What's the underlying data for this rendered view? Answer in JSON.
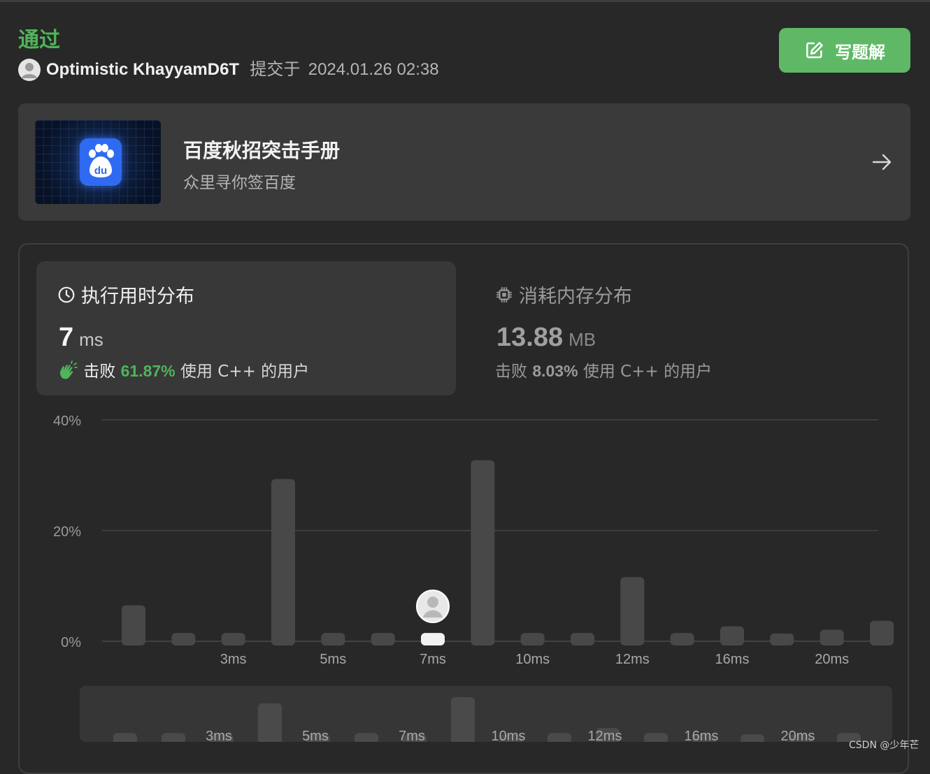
{
  "header": {
    "status": "通过",
    "username": "Optimistic KhayyamD6T",
    "submitted_label": "提交于",
    "submitted_time": "2024.01.26 02:38"
  },
  "write_button": {
    "label": "写题解",
    "icon": "edit-icon"
  },
  "promo": {
    "title": "百度秋招突击手册",
    "subtitle": "众里寻你签百度",
    "image_icon": "baidu-logo",
    "arrow_icon": "arrow-right-icon"
  },
  "runtime": {
    "title": "执行用时分布",
    "icon": "clock-icon",
    "value": "7",
    "unit": "ms",
    "beat_prefix": "击败",
    "beat_percent": "61.87%",
    "beat_suffix": "使用 C++ 的用户",
    "beat_icon": "clap-icon"
  },
  "memory": {
    "title": "消耗内存分布",
    "icon": "chip-icon",
    "value": "13.88",
    "unit": "MB",
    "beat_prefix": "击败",
    "beat_percent": "8.03%",
    "beat_suffix": "使用 C++ 的用户"
  },
  "chart_data": {
    "type": "bar",
    "y_ticks": [
      "40%",
      "20%",
      "0%"
    ],
    "ylim": [
      0,
      40
    ],
    "x_tick_labels": [
      "3ms",
      "5ms",
      "7ms",
      "10ms",
      "12ms",
      "16ms",
      "20ms"
    ],
    "x_tick_bar_index": [
      2,
      4,
      6,
      8,
      10,
      12,
      14
    ],
    "values": [
      6.5,
      1.5,
      1.5,
      29.3,
      1.5,
      1.5,
      1.5,
      32.7,
      1.5,
      1.5,
      11.6,
      1.5,
      2.7,
      1.4,
      2.1,
      3.7
    ],
    "highlight_index": 6,
    "bar_color": "#484848",
    "highlight_color": "#f2f2f2",
    "grid": true
  },
  "mini_chart": {
    "x_tick_labels": [
      "3ms",
      "5ms",
      "7ms",
      "10ms",
      "12ms",
      "16ms",
      "20ms"
    ],
    "values": [
      1.2,
      1.2,
      1.0,
      6.0,
      1.0,
      1.2,
      1.0,
      7.0,
      1.0,
      1.2,
      2.0,
      1.2,
      1.0,
      1.0,
      1.0,
      1.2
    ]
  },
  "watermark": "CSDN @少年芒",
  "colors": {
    "accent_green": "#5fb865",
    "status_green": "#4fb45a",
    "background": "#282828"
  }
}
